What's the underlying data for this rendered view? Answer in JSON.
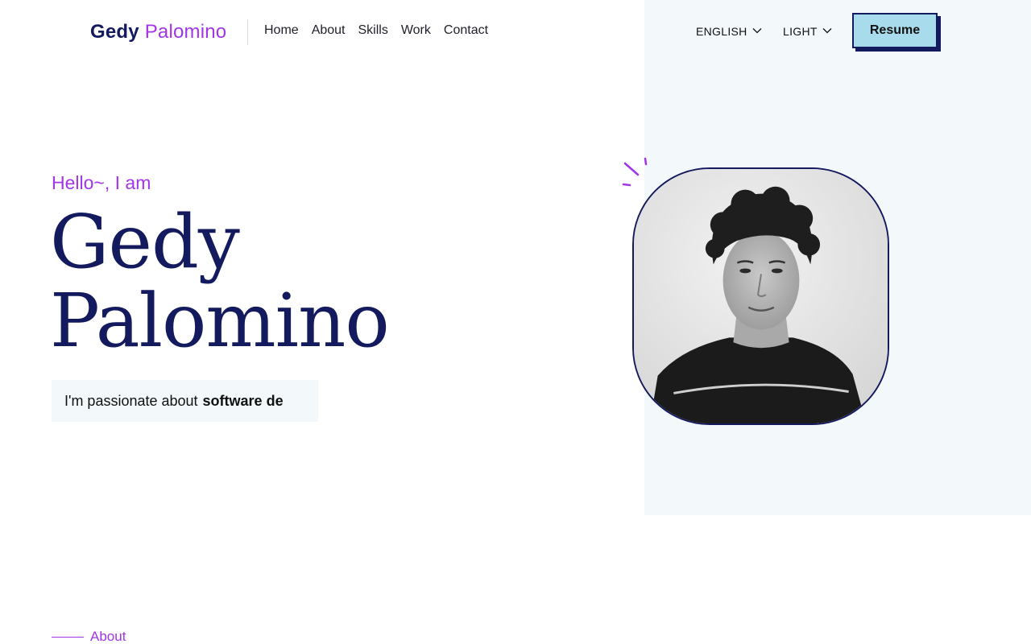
{
  "header": {
    "logo_first": "Gedy",
    "logo_last": "Palomino",
    "nav": [
      "Home",
      "About",
      "Skills",
      "Work",
      "Contact"
    ],
    "language": "ENGLISH",
    "theme": "LIGHT",
    "resume_label": "Resume"
  },
  "hero": {
    "greeting": "Hello~, I am",
    "name_line1": "Gedy",
    "name_line2": "Palomino",
    "tagline_prefix": "I'm passionate about",
    "tagline_highlight": "software de"
  },
  "about": {
    "section_label": "About"
  },
  "colors": {
    "navy": "#131a5e",
    "purple": "#a335e8",
    "panel_bg": "#f3f8fb",
    "resume_bg": "#a8dbec"
  },
  "icons": {
    "dropdown": "chevron-down-icon",
    "decoration": "sparkle-lines-icon"
  }
}
